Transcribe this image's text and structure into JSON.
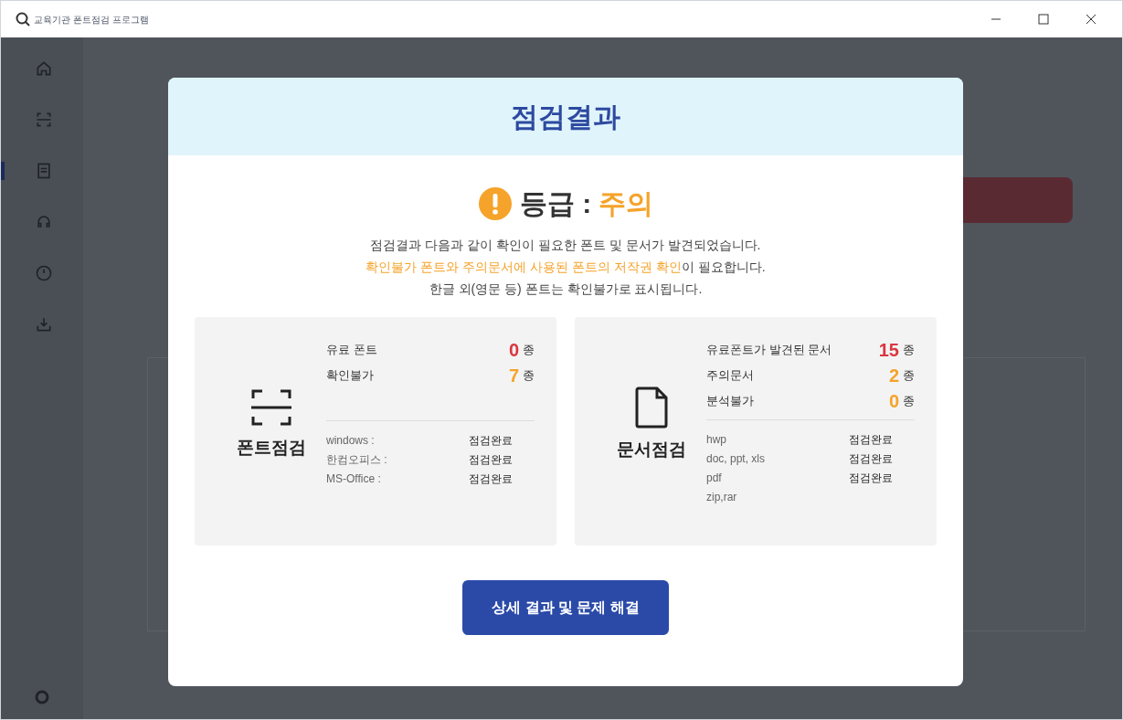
{
  "window": {
    "title": "교육기관 폰트점검 프로그램"
  },
  "sidebar": {
    "items": [
      {
        "selected": false
      },
      {
        "selected": false
      },
      {
        "selected": true
      },
      {
        "selected": false
      },
      {
        "selected": false
      },
      {
        "selected": false
      }
    ]
  },
  "modal": {
    "title": "점검결과",
    "grade_label": "등급 : ",
    "grade": "주의",
    "lines": [
      [
        {
          "text": "점검결과 다음과 같이 확인이 필요한 폰트 및 문서가 발견되었습니다.",
          "highlight": false
        }
      ],
      [
        {
          "text": "확인불가 폰트와 주의문서에 사용된 폰트의 저작권 확인",
          "highlight": true
        },
        {
          "text": "이 필요합니다.",
          "highlight": false
        }
      ],
      [
        {
          "text": "한글 외(영문 등) 폰트는 확인불가로 표시됩니다.",
          "highlight": false
        }
      ]
    ],
    "cards": [
      {
        "kind": "font",
        "name": "폰트점검",
        "counts": [
          {
            "label": "유료 폰트",
            "value": "0",
            "unit": "종",
            "color": "#d9363e"
          },
          {
            "label": "확인불가",
            "value": "7",
            "unit": "종",
            "color": "#f5a32a"
          }
        ],
        "status": [
          {
            "label": "windows :",
            "status": "점검완료"
          },
          {
            "label": "한컴오피스 :",
            "status": "점검완료"
          },
          {
            "label": "MS-Office :",
            "status": "점검완료"
          }
        ]
      },
      {
        "kind": "doc",
        "name": "문서점검",
        "counts": [
          {
            "label": "유료폰트가 발견된 문서",
            "value": "15",
            "unit": "종",
            "color": "#d9363e"
          },
          {
            "label": "주의문서",
            "value": "2",
            "unit": "종",
            "color": "#f5a32a"
          },
          {
            "label": "분석불가",
            "value": "0",
            "unit": "종",
            "color": "#f5a32a"
          }
        ],
        "status": [
          {
            "label": "hwp",
            "status": "점검완료"
          },
          {
            "label": "doc, ppt, xls",
            "status": "점검완료"
          },
          {
            "label": "pdf",
            "status": "점검완료"
          },
          {
            "label": "zip,rar"
          }
        ]
      }
    ],
    "button": "상세 결과 및 문제 해결"
  }
}
